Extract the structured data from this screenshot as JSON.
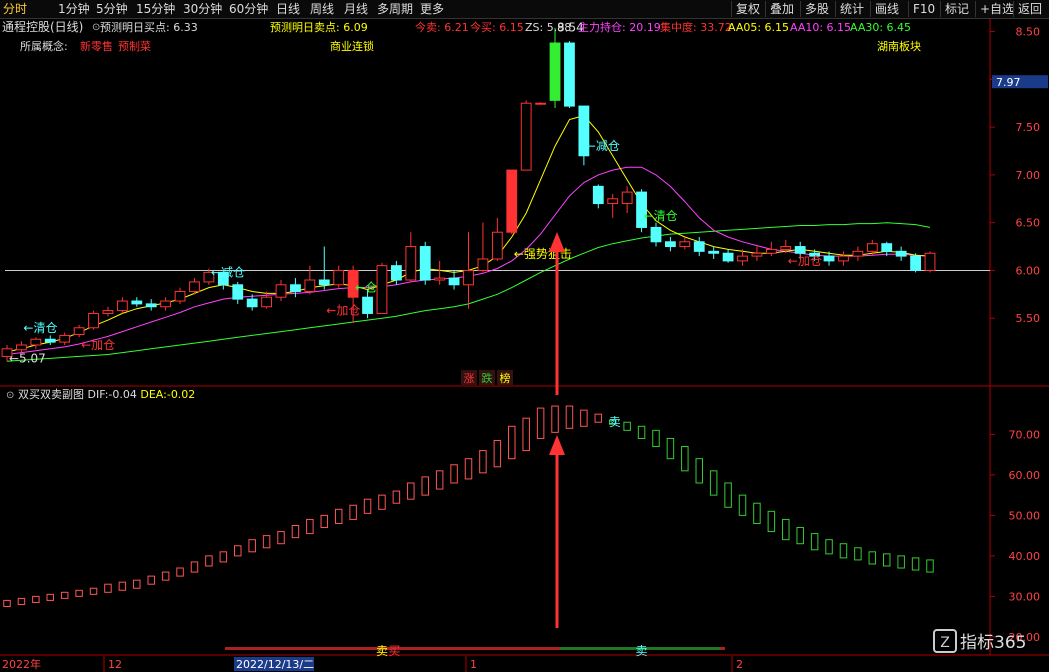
{
  "toolbar": {
    "left": [
      "分时",
      "1分钟",
      "5分钟",
      "15分钟",
      "30分钟",
      "60分钟",
      "日线",
      "周线",
      "月线",
      "多周期",
      "更多"
    ],
    "active": "分时",
    "right": [
      "复权",
      "叠加",
      "多股",
      "统计",
      "画线",
      "F10",
      "标记",
      "+自选",
      "返回"
    ]
  },
  "header": {
    "stock": "通程控股(日线)",
    "items": [
      {
        "label": "预测明日买点",
        "value": "6.33",
        "color": "#dddddd"
      },
      {
        "label": "预测明日卖点",
        "value": "6.09",
        "color": "#ffff00"
      },
      {
        "label": "今卖",
        "value": "6.21",
        "color": "#ff3333"
      },
      {
        "label": "今买",
        "value": "6.15",
        "color": "#ff3333"
      },
      {
        "label": "ZS",
        "value": "5.98",
        "color": "#dddddd"
      },
      {
        "label": "主力持仓",
        "value": "20.19",
        "color": "#ff44ff"
      },
      {
        "label": "集中度",
        "value": "33.72",
        "color": "#ff3333"
      },
      {
        "label": "AA05",
        "value": "6.15",
        "color": "#ffff00"
      },
      {
        "label": "AA10",
        "value": "6.15",
        "color": "#ff44ff"
      },
      {
        "label": "AA30",
        "value": "6.45",
        "color": "#33ff33"
      }
    ]
  },
  "concepts": {
    "label": "所属概念:",
    "items": [
      "新零售",
      "预制菜"
    ],
    "middle": "商业连锁",
    "right": "湖南板块"
  },
  "indicator": {
    "title": "双买双卖副图",
    "dif_label": "DIF",
    "dif": "-0.04",
    "dea_label": "DEA",
    "dea": "-0.02"
  },
  "zhangdiebang": [
    "涨",
    "跌",
    "榜"
  ],
  "timeline": {
    "labels": [
      "2022年",
      "12",
      "2022/12/13/二",
      "1",
      "2"
    ]
  },
  "brand": "指标365",
  "colors": {
    "up": "#ff3333",
    "down": "#54ffff",
    "limitup": "#ff3333",
    "green": "#33cc33",
    "ma5": "#ffff00",
    "ma10": "#ff44ff",
    "ma30": "#33ff33",
    "bg": "#000000",
    "axis": "#b00000"
  },
  "chart_data": [
    {
      "type": "candlestick",
      "title": "通程控股(日线)",
      "y_ticks": [
        5.5,
        6.0,
        6.5,
        7.0,
        7.5,
        8.0,
        8.5
      ],
      "ylim": [
        5.0,
        8.6
      ],
      "current_price_tag": "7.97",
      "reference_line": 6.0,
      "candles": [
        [
          5.1,
          5.18,
          5.22,
          5.05
        ],
        [
          5.17,
          5.22,
          5.26,
          5.14
        ],
        [
          5.22,
          5.28,
          5.3,
          5.18
        ],
        [
          5.28,
          5.25,
          5.32,
          5.22
        ],
        [
          5.25,
          5.32,
          5.35,
          5.22
        ],
        [
          5.33,
          5.4,
          5.43,
          5.3
        ],
        [
          5.4,
          5.55,
          5.58,
          5.38
        ],
        [
          5.55,
          5.58,
          5.62,
          5.52
        ],
        [
          5.58,
          5.68,
          5.72,
          5.55
        ],
        [
          5.68,
          5.65,
          5.72,
          5.62
        ],
        [
          5.65,
          5.62,
          5.7,
          5.58
        ],
        [
          5.62,
          5.68,
          5.72,
          5.58
        ],
        [
          5.68,
          5.78,
          5.82,
          5.65
        ],
        [
          5.78,
          5.88,
          5.92,
          5.75
        ],
        [
          5.88,
          5.98,
          6.02,
          5.85
        ],
        [
          5.98,
          5.85,
          6.0,
          5.8
        ],
        [
          5.85,
          5.7,
          5.88,
          5.65
        ],
        [
          5.7,
          5.62,
          5.75,
          5.58
        ],
        [
          5.62,
          5.72,
          5.78,
          5.6
        ],
        [
          5.72,
          5.85,
          5.9,
          5.68
        ],
        [
          5.85,
          5.78,
          5.92,
          5.72
        ],
        [
          5.78,
          5.9,
          6.05,
          5.75
        ],
        [
          5.9,
          5.85,
          6.25,
          5.8
        ],
        [
          5.85,
          6.0,
          6.05,
          5.82
        ],
        [
          6.0,
          5.72,
          6.05,
          5.45
        ],
        [
          5.72,
          5.55,
          5.8,
          5.5
        ],
        [
          5.55,
          6.05,
          6.08,
          5.55
        ],
        [
          6.05,
          5.9,
          6.1,
          5.85
        ],
        [
          5.9,
          6.25,
          6.4,
          5.88
        ],
        [
          6.25,
          5.9,
          6.3,
          5.85
        ],
        [
          5.9,
          5.92,
          6.1,
          5.85
        ],
        [
          5.92,
          5.85,
          6.0,
          5.8
        ],
        [
          5.85,
          6.0,
          6.4,
          5.6
        ],
        [
          6.0,
          6.12,
          6.5,
          5.98
        ],
        [
          6.12,
          6.4,
          6.55,
          6.1
        ],
        [
          6.4,
          7.05,
          7.05,
          6.38
        ],
        [
          7.05,
          7.75,
          7.78,
          7.7
        ],
        [
          7.75,
          7.75,
          7.76,
          7.74
        ],
        [
          7.78,
          8.38,
          8.54,
          7.7
        ],
        [
          8.38,
          7.72,
          8.4,
          7.7
        ],
        [
          7.72,
          7.2,
          7.25,
          7.1
        ],
        [
          6.88,
          6.7,
          6.9,
          6.65
        ],
        [
          6.7,
          6.75,
          6.8,
          6.55
        ],
        [
          6.7,
          6.82,
          6.88,
          6.6
        ],
        [
          6.82,
          6.45,
          6.85,
          6.4
        ],
        [
          6.45,
          6.3,
          6.5,
          6.25
        ],
        [
          6.3,
          6.25,
          6.35,
          6.2
        ],
        [
          6.25,
          6.3,
          6.35,
          6.22
        ],
        [
          6.3,
          6.2,
          6.35,
          6.15
        ],
        [
          6.2,
          6.18,
          6.25,
          6.12
        ],
        [
          6.18,
          6.1,
          6.22,
          6.08
        ],
        [
          6.1,
          6.15,
          6.22,
          6.05
        ],
        [
          6.15,
          6.18,
          6.25,
          6.1
        ],
        [
          6.18,
          6.22,
          6.3,
          6.15
        ],
        [
          6.22,
          6.25,
          6.32,
          6.18
        ],
        [
          6.25,
          6.18,
          6.3,
          6.12
        ],
        [
          6.18,
          6.15,
          6.22,
          6.1
        ],
        [
          6.15,
          6.1,
          6.2,
          6.05
        ],
        [
          6.1,
          6.15,
          6.2,
          6.05
        ],
        [
          6.15,
          6.2,
          6.25,
          6.1
        ],
        [
          6.2,
          6.28,
          6.32,
          6.15
        ],
        [
          6.28,
          6.2,
          6.3,
          6.15
        ],
        [
          6.2,
          6.15,
          6.25,
          6.1
        ],
        [
          6.15,
          6.0,
          6.18,
          5.98
        ],
        [
          6.0,
          6.18,
          6.2,
          5.98
        ]
      ],
      "ma5": [
        5.15,
        5.18,
        5.22,
        5.25,
        5.29,
        5.35,
        5.42,
        5.48,
        5.55,
        5.6,
        5.63,
        5.66,
        5.7,
        5.76,
        5.82,
        5.85,
        5.82,
        5.78,
        5.76,
        5.76,
        5.78,
        5.82,
        5.84,
        5.86,
        5.84,
        5.8,
        5.85,
        5.9,
        5.98,
        6.02,
        6.0,
        5.98,
        6.0,
        6.05,
        6.15,
        6.35,
        6.6,
        6.95,
        7.3,
        7.58,
        7.62,
        7.45,
        7.2,
        6.95,
        6.7,
        6.52,
        6.42,
        6.35,
        6.3,
        6.25,
        6.22,
        6.2,
        6.18,
        6.18,
        6.2,
        6.22,
        6.2,
        6.18,
        6.16,
        6.16,
        6.18,
        6.2,
        6.19,
        6.16,
        6.15
      ],
      "ma10": [
        5.12,
        5.14,
        5.16,
        5.18,
        5.2,
        5.23,
        5.27,
        5.31,
        5.36,
        5.41,
        5.46,
        5.51,
        5.56,
        5.62,
        5.66,
        5.7,
        5.72,
        5.73,
        5.74,
        5.75,
        5.76,
        5.77,
        5.79,
        5.81,
        5.82,
        5.82,
        5.83,
        5.85,
        5.88,
        5.9,
        5.91,
        5.92,
        5.94,
        5.97,
        6.02,
        6.1,
        6.22,
        6.38,
        6.58,
        6.78,
        6.92,
        7.0,
        7.05,
        7.08,
        7.08,
        7.0,
        6.88,
        6.72,
        6.55,
        6.42,
        6.35,
        6.3,
        6.26,
        6.22,
        6.2,
        6.18,
        6.16,
        6.15,
        6.15,
        6.15,
        6.16,
        6.17,
        6.17,
        6.16,
        6.15
      ],
      "ma30": [
        5.05,
        5.06,
        5.07,
        5.08,
        5.09,
        5.1,
        5.11,
        5.12,
        5.14,
        5.16,
        5.18,
        5.2,
        5.22,
        5.24,
        5.26,
        5.28,
        5.3,
        5.32,
        5.34,
        5.36,
        5.38,
        5.4,
        5.42,
        5.44,
        5.46,
        5.48,
        5.5,
        5.52,
        5.55,
        5.58,
        5.6,
        5.62,
        5.65,
        5.7,
        5.75,
        5.82,
        5.9,
        5.98,
        6.05,
        6.12,
        6.18,
        6.24,
        6.28,
        6.31,
        6.34,
        6.36,
        6.38,
        6.39,
        6.4,
        6.41,
        6.42,
        6.43,
        6.44,
        6.45,
        6.46,
        6.47,
        6.47,
        6.48,
        6.48,
        6.49,
        6.49,
        6.5,
        6.49,
        6.48,
        6.45
      ],
      "annotations": [
        {
          "text": "←清仓",
          "idx": 1,
          "price": 5.4,
          "color": "#54ffff"
        },
        {
          "text": "←5.07",
          "idx": 0,
          "price": 5.08,
          "color": "#dddddd"
        },
        {
          "text": "←加仓",
          "idx": 5,
          "price": 5.22,
          "color": "#ff3333"
        },
        {
          "text": "←减仓",
          "idx": 14,
          "price": 5.98,
          "color": "#54ffff"
        },
        {
          "text": "←加仓",
          "idx": 22,
          "price": 5.58,
          "color": "#ff3333"
        },
        {
          "text": "←仓",
          "idx": 24,
          "price": 5.82,
          "color": "#33ff33"
        },
        {
          "text": "←强势狙击",
          "idx": 35,
          "price": 6.17,
          "color": "#ffff00"
        },
        {
          "text": "←减仓",
          "idx": 40,
          "price": 7.3,
          "color": "#54ffff"
        },
        {
          "text": "←清仓",
          "idx": 44,
          "price": 6.57,
          "color": "#33ff33"
        },
        {
          "text": "←加仓",
          "idx": 54,
          "price": 6.1,
          "color": "#ff3333"
        },
        {
          "text": "8.54",
          "idx": 38,
          "price": 8.54,
          "color": "#dddddd"
        }
      ]
    },
    {
      "type": "bar",
      "title": "双买双卖副图",
      "y_ticks": [
        20.0,
        30.0,
        40.0,
        50.0,
        60.0,
        70.0
      ],
      "ylim": [
        17,
        78
      ],
      "bars": [
        {
          "v": [
            27.5,
            29
          ],
          "s": "up"
        },
        {
          "v": [
            28,
            29.5
          ],
          "s": "up"
        },
        {
          "v": [
            28.5,
            30
          ],
          "s": "up"
        },
        {
          "v": [
            29,
            30.5
          ],
          "s": "up"
        },
        {
          "v": [
            29.5,
            31
          ],
          "s": "up"
        },
        {
          "v": [
            30,
            31.5
          ],
          "s": "up"
        },
        {
          "v": [
            30.5,
            32
          ],
          "s": "up"
        },
        {
          "v": [
            31,
            33
          ],
          "s": "up"
        },
        {
          "v": [
            31.5,
            33.5
          ],
          "s": "up"
        },
        {
          "v": [
            32,
            34
          ],
          "s": "up"
        },
        {
          "v": [
            33,
            35
          ],
          "s": "up"
        },
        {
          "v": [
            34,
            36
          ],
          "s": "up"
        },
        {
          "v": [
            35,
            37
          ],
          "s": "up"
        },
        {
          "v": [
            36,
            38.5
          ],
          "s": "up"
        },
        {
          "v": [
            37.5,
            40
          ],
          "s": "up"
        },
        {
          "v": [
            38.5,
            41
          ],
          "s": "up"
        },
        {
          "v": [
            40,
            42.5
          ],
          "s": "up"
        },
        {
          "v": [
            41,
            44
          ],
          "s": "up"
        },
        {
          "v": [
            42,
            45
          ],
          "s": "up"
        },
        {
          "v": [
            43,
            46
          ],
          "s": "up"
        },
        {
          "v": [
            44.5,
            47.5
          ],
          "s": "up"
        },
        {
          "v": [
            45.5,
            49
          ],
          "s": "up"
        },
        {
          "v": [
            47,
            50
          ],
          "s": "up"
        },
        {
          "v": [
            48,
            51.5
          ],
          "s": "up"
        },
        {
          "v": [
            49,
            52.5
          ],
          "s": "up"
        },
        {
          "v": [
            50.5,
            54
          ],
          "s": "up"
        },
        {
          "v": [
            51.5,
            55
          ],
          "s": "up"
        },
        {
          "v": [
            53,
            56
          ],
          "s": "up"
        },
        {
          "v": [
            54,
            58
          ],
          "s": "up"
        },
        {
          "v": [
            55,
            59.5
          ],
          "s": "up"
        },
        {
          "v": [
            56.5,
            61
          ],
          "s": "up"
        },
        {
          "v": [
            58,
            62.5
          ],
          "s": "up"
        },
        {
          "v": [
            59,
            64
          ],
          "s": "up"
        },
        {
          "v": [
            60.5,
            66
          ],
          "s": "up"
        },
        {
          "v": [
            62,
            68.5
          ],
          "s": "up"
        },
        {
          "v": [
            64,
            72
          ],
          "s": "up"
        },
        {
          "v": [
            66,
            74
          ],
          "s": "up"
        },
        {
          "v": [
            69,
            76.5
          ],
          "s": "up"
        },
        {
          "v": [
            70.5,
            77
          ],
          "s": "up"
        },
        {
          "v": [
            71.5,
            77
          ],
          "s": "up"
        },
        {
          "v": [
            72,
            76
          ],
          "s": "up"
        },
        {
          "v": [
            73,
            75
          ],
          "s": "up"
        },
        {
          "v": [
            72.5,
            73.5
          ],
          "s": "down"
        },
        {
          "v": [
            71,
            73
          ],
          "s": "down"
        },
        {
          "v": [
            69,
            72
          ],
          "s": "down"
        },
        {
          "v": [
            67,
            71
          ],
          "s": "down"
        },
        {
          "v": [
            64,
            69
          ],
          "s": "down"
        },
        {
          "v": [
            61,
            67
          ],
          "s": "down"
        },
        {
          "v": [
            58,
            64
          ],
          "s": "down"
        },
        {
          "v": [
            55,
            61
          ],
          "s": "down"
        },
        {
          "v": [
            52,
            58
          ],
          "s": "down"
        },
        {
          "v": [
            50,
            55
          ],
          "s": "down"
        },
        {
          "v": [
            48,
            53
          ],
          "s": "down"
        },
        {
          "v": [
            46,
            51
          ],
          "s": "down"
        },
        {
          "v": [
            44,
            49
          ],
          "s": "down"
        },
        {
          "v": [
            43,
            47
          ],
          "s": "down"
        },
        {
          "v": [
            41.5,
            45.5
          ],
          "s": "down"
        },
        {
          "v": [
            40.5,
            44
          ],
          "s": "down"
        },
        {
          "v": [
            39.5,
            43
          ],
          "s": "down"
        },
        {
          "v": [
            39,
            42
          ],
          "s": "down"
        },
        {
          "v": [
            38,
            41
          ],
          "s": "down"
        },
        {
          "v": [
            37.5,
            40.5
          ],
          "s": "down"
        },
        {
          "v": [
            37,
            40
          ],
          "s": "down"
        },
        {
          "v": [
            36.5,
            39.5
          ],
          "s": "down"
        },
        {
          "v": [
            36,
            39
          ],
          "s": "down"
        }
      ],
      "signals": [
        {
          "text": "卖",
          "idx": 42,
          "value": 73.5,
          "color": "#54ffff"
        }
      ],
      "bottom_labels": [
        {
          "text": "卖",
          "idx": 26,
          "color": "#ffff00"
        },
        {
          "text": "买",
          "idx": 27,
          "color": "#ff3333"
        },
        {
          "text": "卖",
          "idx": 44,
          "color": "#54ffff"
        }
      ]
    }
  ]
}
